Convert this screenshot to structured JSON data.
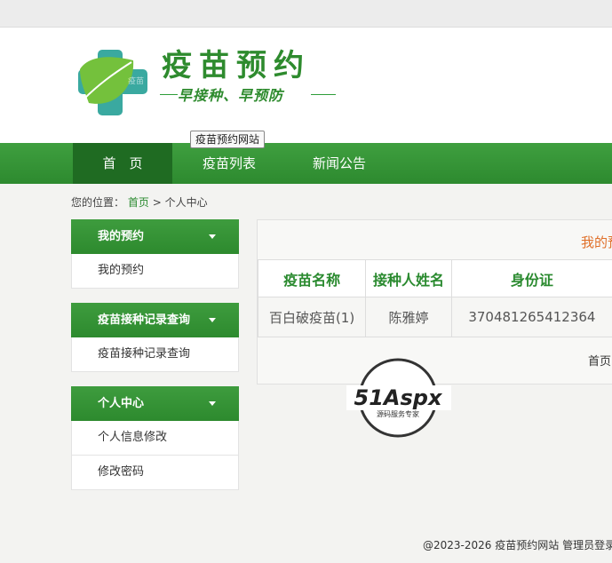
{
  "header": {
    "logo_title": "疫苗预约",
    "logo_slogan": "早接种、早预防",
    "logo_badge": "疫苗",
    "tooltip": "疫苗预约网站"
  },
  "nav": {
    "items": [
      {
        "label": "首　页",
        "active": true
      },
      {
        "label": "疫苗列表",
        "active": false
      },
      {
        "label": "新闻公告",
        "active": false
      }
    ]
  },
  "breadcrumb": {
    "prefix": "您的位置：",
    "home": "首页",
    "separator": ">",
    "current": "个人中心"
  },
  "sidebar": {
    "groups": [
      {
        "title": "我的预约",
        "items": [
          "我的预约"
        ]
      },
      {
        "title": "疫苗接种记录查询",
        "items": [
          "疫苗接种记录查询"
        ]
      },
      {
        "title": "个人中心",
        "items": [
          "个人信息修改",
          "修改密码"
        ]
      }
    ]
  },
  "main": {
    "panel_title": "我的预约",
    "table": {
      "headers": [
        "疫苗名称",
        "接种人姓名",
        "身份证"
      ],
      "rows": [
        [
          "百白破疫苗(1)",
          "陈雅婷",
          "370481265412364"
        ]
      ]
    },
    "pager_first": "首页"
  },
  "watermark": {
    "brand": "51Aspx",
    "tagline": "源码服务专家"
  },
  "footer": {
    "copyright": "@2023-2026 疫苗预约网站",
    "admin_link": "管理员登录"
  },
  "colors": {
    "brand_green": "#2e8b2e",
    "nav_active": "#1f6b22",
    "accent_orange": "#e0702a"
  }
}
